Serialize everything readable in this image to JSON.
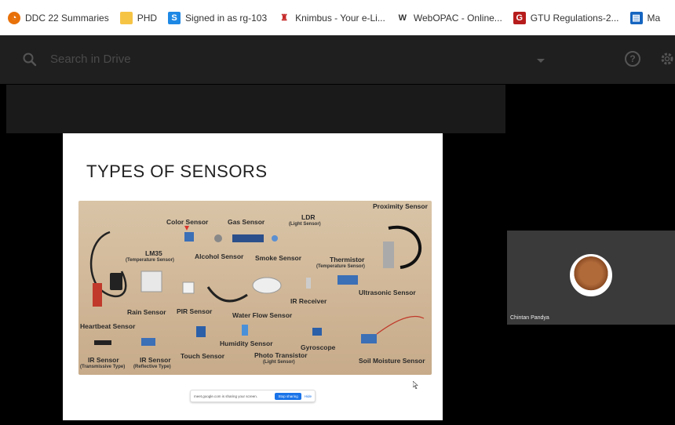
{
  "bookmarks": [
    {
      "label": "DDC 22 Summaries",
      "icon": "chrome-color-icon",
      "color": "#e8710a"
    },
    {
      "label": "PHD",
      "icon": "folder-icon",
      "color": "#f6c445"
    },
    {
      "label": "Signed in as rg-103",
      "icon": "s-logo-icon",
      "color": "#1e88e5"
    },
    {
      "label": "Knimbus - Your e-Li...",
      "icon": "knimbus-icon",
      "color": "#c62828"
    },
    {
      "label": "WebOPAC - Online...",
      "icon": "webopac-icon",
      "color": "#333333"
    },
    {
      "label": "GTU Regulations-2...",
      "icon": "gtu-icon",
      "color": "#b71c1c"
    },
    {
      "label": "Ma",
      "icon": "calendar-icon",
      "color": "#1565c0"
    }
  ],
  "drive": {
    "search_placeholder": "Search in Drive",
    "help_label": "?"
  },
  "slide": {
    "title": "TYPES OF SENSORS",
    "labels": {
      "color_sensor": "Color Sensor",
      "gas_sensor": "Gas Sensor",
      "ldr": "LDR",
      "ldr_sub": "(Light Sensor)",
      "proximity_sensor": "Proximity Sensor",
      "lm35": "LM35",
      "lm35_sub": "(Temperature Sensor)",
      "alcohol_sensor": "Alcohol Sensor",
      "smoke_sensor": "Smoke Sensor",
      "thermistor": "Thermistor",
      "thermistor_sub": "(Temperature Sensor)",
      "ir_receiver": "IR Receiver",
      "ultrasonic_sensor": "Ultrasonic Sensor",
      "rain_sensor": "Rain Sensor",
      "pir_sensor": "PIR Sensor",
      "water_flow_sensor": "Water Flow Sensor",
      "heartbeat_sensor": "Heartbeat Sensor",
      "humidity_sensor": "Humidity Sensor",
      "gyroscope": "Gyroscope",
      "ir_sensor_1": "IR Sensor",
      "ir_sensor_1_sub": "(Transmissive Type)",
      "ir_sensor_2": "IR Sensor",
      "ir_sensor_2_sub": "(Reflective Type)",
      "touch_sensor": "Touch Sensor",
      "photo_transistor": "Photo Transistor",
      "photo_transistor_sub": "(Light Sensor)",
      "soil_moisture_sensor": "Soil Moisture Sensor"
    }
  },
  "share_bar": {
    "text": "meet.google.com is sharing your screen.",
    "stop_label": "Stop sharing",
    "hide_label": "Hide"
  },
  "participant": {
    "name": "Chintan Pandya"
  }
}
